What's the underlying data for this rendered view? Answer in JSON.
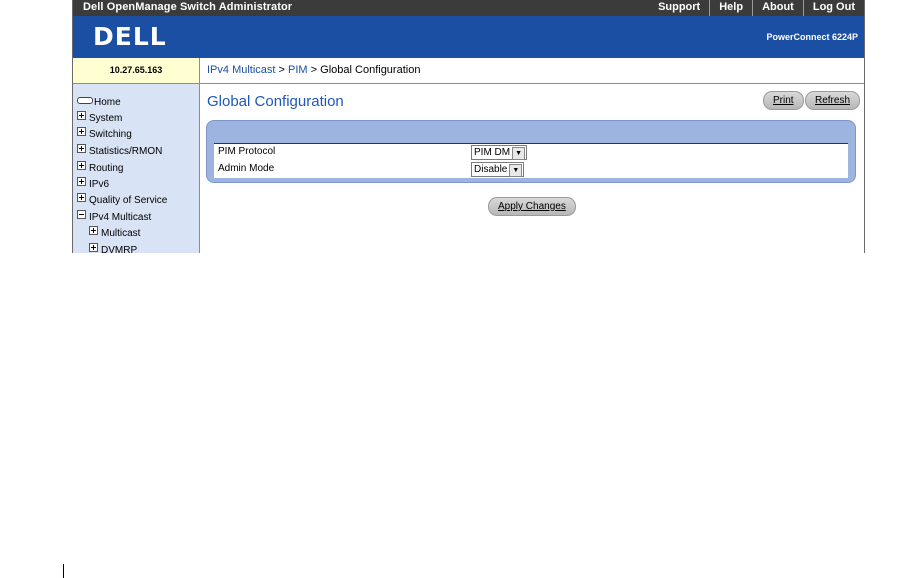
{
  "header": {
    "app_title": "Dell OpenManage Switch Administrator",
    "links": [
      "Support",
      "Help",
      "About",
      "Log Out"
    ],
    "logo": "DELL",
    "model": "PowerConnect 6224P"
  },
  "sidebar": {
    "ip_address": "10.27.65.163",
    "items": [
      {
        "label": "Home",
        "expander": "home-icon"
      },
      {
        "label": "System",
        "expander": "plus"
      },
      {
        "label": "Switching",
        "expander": "plus"
      },
      {
        "label": "Statistics/RMON",
        "expander": "plus"
      },
      {
        "label": "Routing",
        "expander": "plus"
      },
      {
        "label": "IPv6",
        "expander": "plus"
      },
      {
        "label": "Quality of Service",
        "expander": "plus"
      },
      {
        "label": "IPv4 Multicast",
        "expander": "minus"
      },
      {
        "label": "Multicast",
        "expander": "plus"
      },
      {
        "label": "DVMRP",
        "expander": "plus"
      }
    ]
  },
  "breadcrumb": {
    "items": [
      "IPv4 Multicast",
      "PIM",
      "Global Configuration"
    ],
    "separator": ">"
  },
  "main": {
    "title": "Global Configuration",
    "print_label": "Print",
    "refresh_label": "Refresh",
    "fields": [
      {
        "label": "PIM Protocol",
        "value": "PIM DM"
      },
      {
        "label": "Admin Mode",
        "value": "Disable"
      }
    ],
    "apply_label": "Apply Changes"
  },
  "colors": {
    "brand_blue": "#1a4fa3",
    "nav_background": "#d8e3f6",
    "panel_blue": "#9db4e0"
  }
}
